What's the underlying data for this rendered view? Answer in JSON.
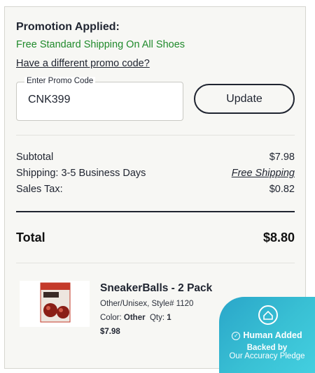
{
  "promo": {
    "title": "Promotion Applied:",
    "message": "Free Standard Shipping On All Shoes",
    "different_link": "Have a different promo code?",
    "field_label": "Enter Promo Code",
    "field_value": "CNK399",
    "update_label": "Update"
  },
  "summary": {
    "subtotal_label": "Subtotal",
    "subtotal_value": "$7.98",
    "shipping_label": "Shipping: 3-5 Business Days",
    "shipping_value": "Free Shipping",
    "tax_label": "Sales Tax:",
    "tax_value": "$0.82",
    "total_label": "Total",
    "total_value": "$8.80"
  },
  "item": {
    "name": "SneakerBalls - 2 Pack",
    "style_line": "Other/Unisex, Style# 1120",
    "color_label": "Color:",
    "color_value": "Other",
    "qty_label": "Qty:",
    "qty_value": "1",
    "price": "$7.98",
    "image_icon": "product-photo"
  },
  "pledge": {
    "line1": "Human Added",
    "line2": "Backed by",
    "line3": "Our Accuracy Pledge",
    "icon": "human-badge-icon"
  },
  "colors": {
    "promo_green": "#1f8a2b",
    "text_navy": "#1f2430",
    "pledge_teal": "#39c0d4"
  }
}
